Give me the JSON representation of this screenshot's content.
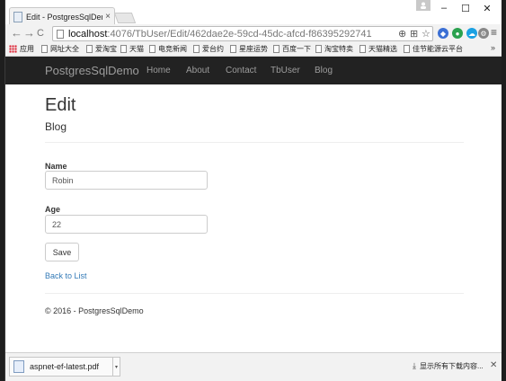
{
  "browser": {
    "tab_title": "Edit - PostgresSqlDemo",
    "tab_close": "×",
    "profile_icon": "user-icon",
    "window_buttons": {
      "minimize": "–",
      "maximize": "☐",
      "close": "✕"
    },
    "nav": {
      "back": "←",
      "forward": "→",
      "reload": "C"
    },
    "url_host": "localhost",
    "url_path": ":4076/TbUser/Edit/462dae2e-59cd-45dc-afcd-f86395292741",
    "menu": "≡",
    "bookmarks": [
      "应用",
      "网址大全",
      "爱淘宝",
      "天猫",
      "电竞新闻",
      "爱台约",
      "星座运势",
      "百度一下",
      "淘宝特卖",
      "天猫精选",
      "佳节能源云平台"
    ],
    "bookmarks_more": "»"
  },
  "navbar": {
    "brand": "PostgresSqlDemo",
    "links": [
      "Home",
      "About",
      "Contact",
      "TbUser",
      "Blog"
    ]
  },
  "page": {
    "title": "Edit",
    "subtitle": "Blog",
    "fields": [
      {
        "label": "Name",
        "value": "Robin"
      },
      {
        "label": "Age",
        "value": "22"
      }
    ],
    "save_label": "Save",
    "back_link": "Back to List",
    "footer": "© 2016 - PostgresSqlDemo"
  },
  "downloads": {
    "file_name": "aspnet-ef-latest.pdf",
    "arrow": "▾",
    "show_all": "显示所有下载内容...",
    "close": "✕"
  }
}
